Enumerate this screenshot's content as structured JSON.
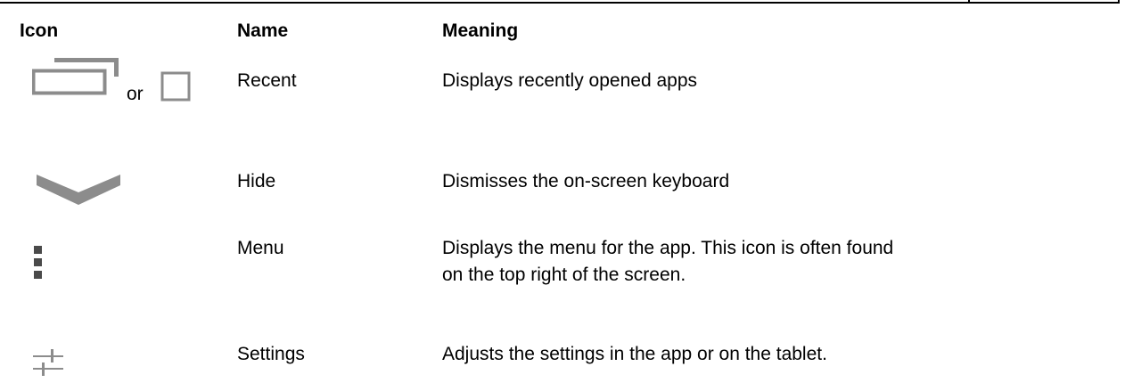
{
  "table": {
    "headers": {
      "icon": "Icon",
      "name": "Name",
      "meaning": "Meaning"
    },
    "rows": [
      {
        "icon": "recent-apps-icon",
        "connector": "or",
        "alt_icon": "square-icon",
        "name": "Recent",
        "meaning": "Displays recently opened apps"
      },
      {
        "icon": "chevron-down-icon",
        "name": "Hide",
        "meaning": "Dismisses the on-screen keyboard"
      },
      {
        "icon": "more-vertical-icon",
        "name": "Menu",
        "meaning": "Displays the menu for the app. This icon is often found on the top right of the screen."
      },
      {
        "icon": "settings-sliders-icon",
        "name": "Settings",
        "meaning": "Adjusts the settings in the app or on the tablet."
      }
    ]
  },
  "colors": {
    "icon_gray": "#8c8c8c",
    "icon_dark": "#4a4a4a",
    "rule": "#000000"
  }
}
